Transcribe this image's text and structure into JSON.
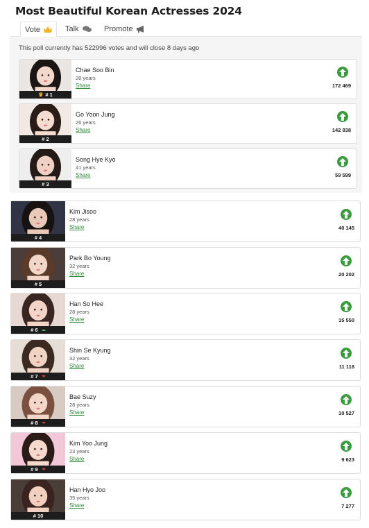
{
  "title": "Most Beautiful Korean Actresses 2024",
  "tabs": [
    {
      "label": "Vote",
      "icon": "crown-icon"
    },
    {
      "label": "Talk",
      "icon": "chat-icon"
    },
    {
      "label": "Promote",
      "icon": "megaphone-icon"
    }
  ],
  "poll_info": "This poll currently has 522996 votes and will close 8 days ago",
  "share_label": "Share",
  "colors": {
    "accent": "#3a9a3e",
    "share": "#2e8b3a",
    "rank_bar": "#1d1d1d",
    "trend_up": "#46b04a",
    "trend_down": "#e04040"
  },
  "entries": [
    {
      "name": "Chae Soo Bin",
      "age": "28 years",
      "rank": "# 1",
      "votes": "172 469",
      "crown": true,
      "trend": ""
    },
    {
      "name": "Go Yoon Jung",
      "age": "26 years",
      "rank": "# 2",
      "votes": "142 838",
      "trend": ""
    },
    {
      "name": "Song Hye Kyo",
      "age": "41 years",
      "rank": "# 3",
      "votes": "59 599",
      "trend": ""
    },
    {
      "name": "Kim Jisoo",
      "age": "28 years",
      "rank": "# 4",
      "votes": "40 145",
      "trend": ""
    },
    {
      "name": "Park Bo Young",
      "age": "32 years",
      "rank": "# 5",
      "votes": "20 202",
      "trend": ""
    },
    {
      "name": "Han So Hee",
      "age": "28 years",
      "rank": "# 6",
      "votes": "15 550",
      "trend": "up"
    },
    {
      "name": "Shin Se Kyung",
      "age": "32 years",
      "rank": "# 7",
      "votes": "11 118",
      "trend": "down"
    },
    {
      "name": "Bae Suzy",
      "age": "28 years",
      "rank": "# 8",
      "votes": "10 527",
      "trend": "down"
    },
    {
      "name": "Kim Yoo Jung",
      "age": "23 years",
      "rank": "# 9",
      "votes": "9 623",
      "trend": "down"
    },
    {
      "name": "Han Hyo Joo",
      "age": "35 years",
      "rank": "# 10",
      "votes": "7 277",
      "trend": ""
    }
  ]
}
